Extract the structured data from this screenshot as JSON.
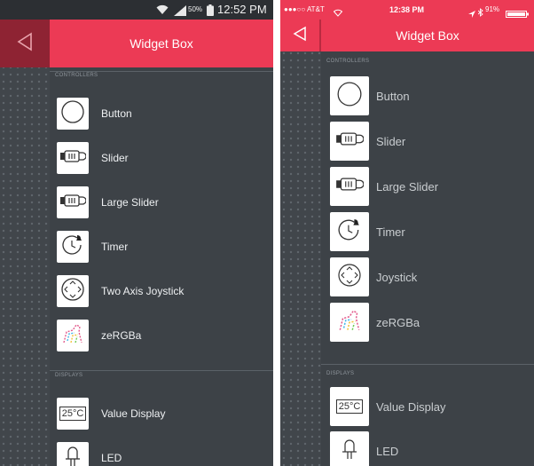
{
  "android": {
    "status": {
      "signal": "50%",
      "time": "12:52 PM"
    },
    "header": {
      "title": "Widget Box"
    },
    "sections": {
      "controllers": "CONTROLLERS",
      "displays": "DISPLAYS"
    },
    "controllers": [
      {
        "label": "Button",
        "icon": "circle-icon"
      },
      {
        "label": "Slider",
        "icon": "slider-icon"
      },
      {
        "label": "Large Slider",
        "icon": "large-slider-icon"
      },
      {
        "label": "Timer",
        "icon": "timer-icon"
      },
      {
        "label": "Two Axis Joystick",
        "icon": "joystick-icon"
      },
      {
        "label": "zeRGBa",
        "icon": "zebra-icon"
      }
    ],
    "displays": [
      {
        "label": "Value Display",
        "icon": "value-display-icon",
        "icon_text": "25°C"
      },
      {
        "label": "LED",
        "icon": "led-icon"
      }
    ]
  },
  "ios": {
    "status": {
      "carrier": "●●●○○ AT&T",
      "time": "12:38 PM",
      "battery": "91%"
    },
    "header": {
      "title": "Widget Box"
    },
    "sections": {
      "controllers": "CONTROLLERS",
      "displays": "DISPLAYS"
    },
    "controllers": [
      {
        "label": "Button",
        "icon": "circle-icon"
      },
      {
        "label": "Slider",
        "icon": "slider-icon"
      },
      {
        "label": "Large Slider",
        "icon": "large-slider-icon"
      },
      {
        "label": "Timer",
        "icon": "timer-icon"
      },
      {
        "label": "Joystick",
        "icon": "joystick-icon"
      },
      {
        "label": "zeRGBa",
        "icon": "zebra-icon"
      }
    ],
    "displays": [
      {
        "label": "Value Display",
        "icon": "value-display-icon",
        "icon_text": "25°C"
      },
      {
        "label": "LED",
        "icon": "led-icon"
      }
    ]
  },
  "colors": {
    "accent": "#ec3a55",
    "accent_dark": "#8e2333",
    "panel": "#3d4247"
  }
}
